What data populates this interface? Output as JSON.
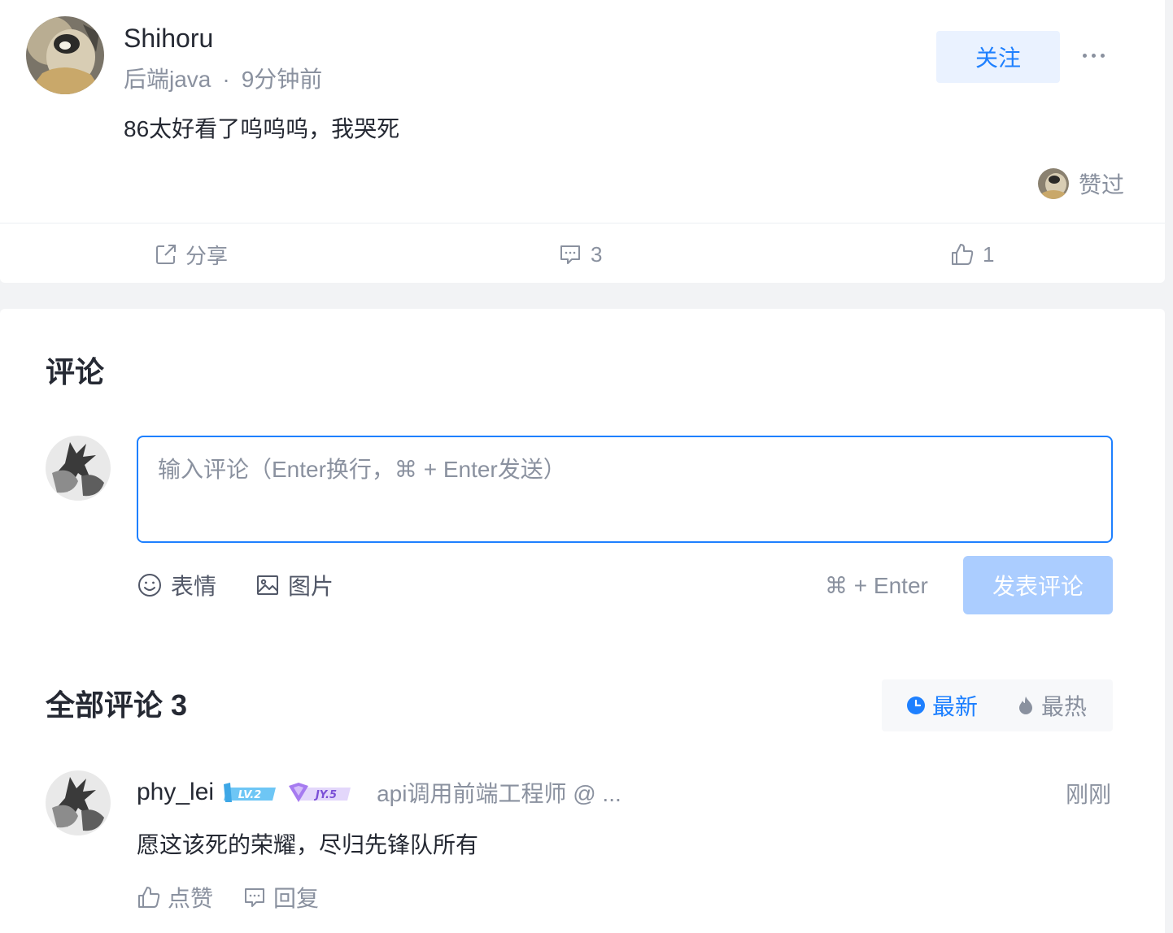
{
  "post": {
    "author": "Shihoru",
    "category": "后端java",
    "separator": "·",
    "time": "9分钟前",
    "content": "86太好看了呜呜呜，我哭死",
    "follow_label": "关注",
    "liked_label": "赞过",
    "actions": {
      "share_label": "分享",
      "comment_count": "3",
      "like_count": "1"
    }
  },
  "comments": {
    "title": "评论",
    "input_placeholder": "输入评论（Enter换行，⌘ + Enter发送）",
    "toolbar": {
      "emoji_label": "表情",
      "image_label": "图片",
      "shortcut_hint": "⌘ + Enter",
      "submit_label": "发表评论"
    },
    "all_title": "全部评论 3",
    "sort": {
      "newest_label": "最新",
      "hottest_label": "最热"
    },
    "list": [
      {
        "name": "phy_lei",
        "level_badge": "LV.2",
        "jy_badge": "JY.5",
        "job": "api调用前端工程师 @ ...",
        "time": "刚刚",
        "text": "愿这该死的荣耀，尽归先锋队所有",
        "like_label": "点赞",
        "reply_label": "回复"
      }
    ]
  },
  "colors": {
    "accent": "#1e80ff",
    "muted": "#8a919f",
    "text": "#252933",
    "background": "#f2f3f5",
    "submit_disabled": "#abcdff"
  }
}
